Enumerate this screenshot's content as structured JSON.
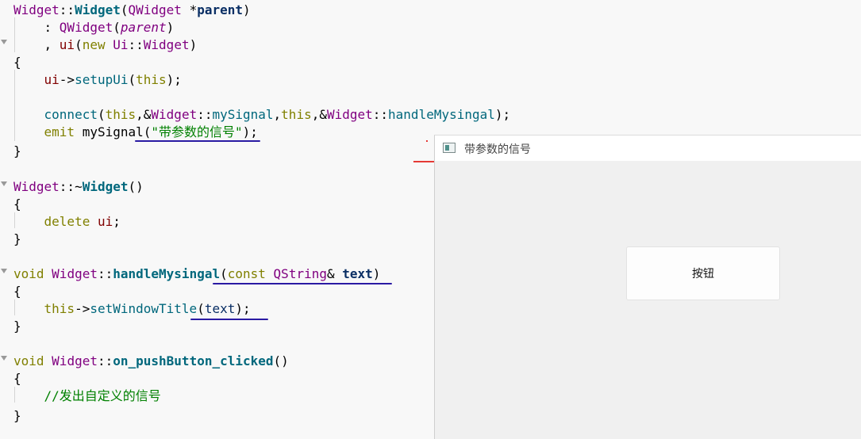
{
  "code": {
    "l1": {
      "a": "Widget",
      "b": "::",
      "c": "Widget",
      "d": "(",
      "e": "QWidget",
      "f": " *",
      "g": "parent",
      "h": ")"
    },
    "l2": {
      "a": "    : ",
      "b": "QWidget",
      "c": "(",
      "d": "parent",
      "e": ")"
    },
    "l3": {
      "a": "    , ",
      "b": "ui",
      "c": "(",
      "d": "new",
      "e": " ",
      "f": "Ui",
      "g": "::",
      "h": "Widget",
      "i": ")"
    },
    "l4": {
      "a": "{"
    },
    "l5": {
      "a": "    ",
      "b": "ui",
      "c": "->",
      "d": "setupUi",
      "e": "(",
      "f": "this",
      "g": ");"
    },
    "l6": {
      "a": "    ",
      "b": "connect",
      "c": "(",
      "d": "this",
      "e": ",&",
      "f": "Widget",
      "g": "::",
      "h": "mySignal",
      "i": ",",
      "j": "this",
      "k": ",&",
      "l": "Widget",
      "m": "::",
      "n": "handleMysingal",
      "o": ");"
    },
    "l7": {
      "a": "    ",
      "b": "emit",
      "c": " mySignal(",
      "d": "\"带参数的信号\"",
      "e": ");"
    },
    "l8": {
      "a": "}"
    },
    "l9": {
      "a": "Widget",
      "b": "::~",
      "c": "Widget",
      "d": "()"
    },
    "l10": {
      "a": "{"
    },
    "l11": {
      "a": "    ",
      "b": "delete",
      "c": " ",
      "d": "ui",
      "e": ";"
    },
    "l12": {
      "a": "}"
    },
    "l13": {
      "a": "void",
      "b": " ",
      "c": "Widget",
      "d": "::",
      "e": "handleMysingal",
      "f": "(",
      "g": "const",
      "h": " ",
      "i": "QString",
      "j": "& ",
      "k": "text",
      "l": ")"
    },
    "l14": {
      "a": "{"
    },
    "l15": {
      "a": "    ",
      "b": "this",
      "c": "->",
      "d": "setWindowTitle",
      "e": "(",
      "f": "text",
      "g": ");"
    },
    "l16": {
      "a": "}"
    },
    "l17": {
      "a": "void",
      "b": " ",
      "c": "Widget",
      "d": "::",
      "e": "on_pushButton_clicked",
      "f": "()"
    },
    "l18": {
      "a": "{"
    },
    "l19": {
      "a": "    ",
      "b": "//发出自定义的信号"
    },
    "l20": {
      "a": "}"
    }
  },
  "window": {
    "title": "带参数的信号",
    "button_label": "按钮"
  },
  "colors": {
    "underline": "#2a1aa3",
    "title_underline": "#e53935"
  }
}
